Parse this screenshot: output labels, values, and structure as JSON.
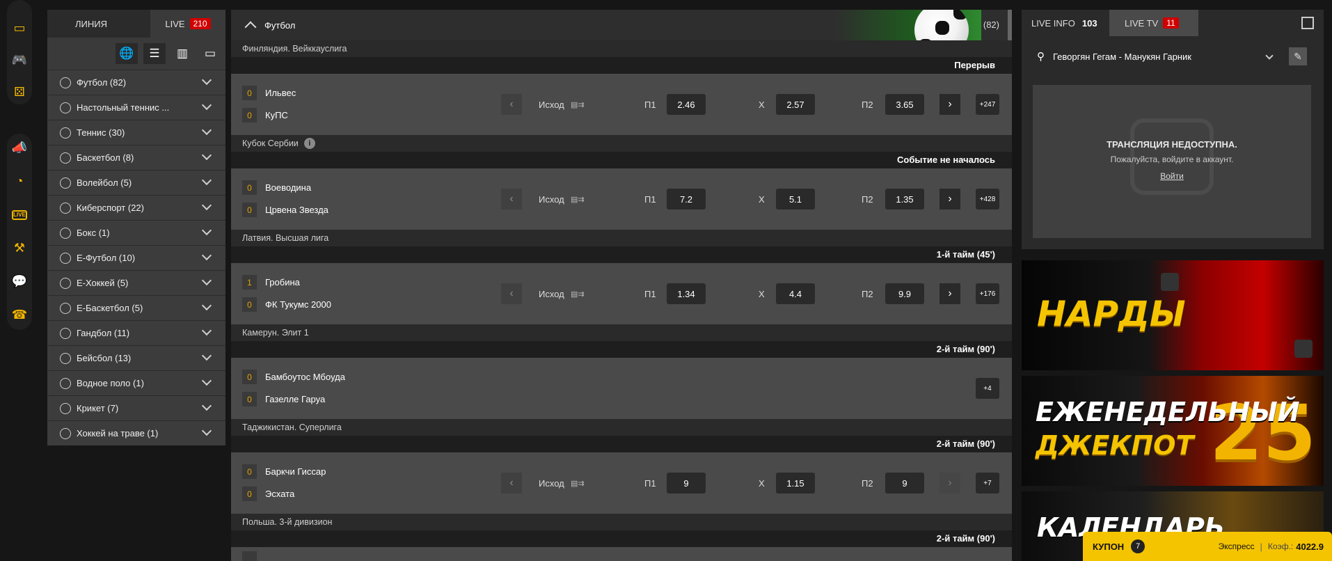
{
  "rail": {
    "icons": [
      "live-icon",
      "gamepad-icon",
      "dice-icon",
      "megaphone-icon",
      "pie-chart-icon",
      "live-small-icon",
      "gavel-icon",
      "chat-icon",
      "phone-icon"
    ],
    "live_small": "LIVE"
  },
  "sports_tabs": {
    "line": "ЛИНИЯ",
    "live": "LIVE",
    "live_count": "210"
  },
  "sports": [
    {
      "label": "Футбол (82)"
    },
    {
      "label": "Настольный теннис ..."
    },
    {
      "label": "Теннис (30)"
    },
    {
      "label": "Баскетбол (8)"
    },
    {
      "label": "Волейбол (5)"
    },
    {
      "label": "Киберспорт (22)"
    },
    {
      "label": "Бокс (1)"
    },
    {
      "label": "Е-Футбол (10)"
    },
    {
      "label": "Е-Хоккей (5)"
    },
    {
      "label": "Е-Баскетбол (5)"
    },
    {
      "label": "Гандбол (11)"
    },
    {
      "label": "Бейсбол (13)"
    },
    {
      "label": "Водное поло (1)"
    },
    {
      "label": "Крикет (7)"
    },
    {
      "label": "Хоккей на траве (1)"
    }
  ],
  "main": {
    "title": "Футбол",
    "count": "(82)"
  },
  "labels": {
    "outcome": "Исход",
    "p1": "П1",
    "x": "X",
    "p2": "П2"
  },
  "events": [
    {
      "league": "Финляндия. Вейккауслига",
      "status": "Перерыв",
      "team1": "Ильвес",
      "score1": "0",
      "team2": "КуПС",
      "score2": "0",
      "p1": "2.46",
      "x": "2.57",
      "p2": "3.65",
      "more": "+247",
      "has_odds": true
    },
    {
      "league": "Кубок Сербии",
      "status": "Событие не началось",
      "team1": "Воеводина",
      "score1": "0",
      "team2": "Црвена Звезда",
      "score2": "0",
      "p1": "7.2",
      "x": "5.1",
      "p2": "1.35",
      "more": "+428",
      "has_odds": true
    },
    {
      "league": "Латвия. Высшая лига",
      "status": "1-й тайм  (45')",
      "team1": "Гробина",
      "score1": "1",
      "team2": "ФК Тукумс 2000",
      "score2": "0",
      "p1": "1.34",
      "x": "4.4",
      "p2": "9.9",
      "more": "+176",
      "has_odds": true
    },
    {
      "league": "Камерун. Элит 1",
      "status": "2-й тайм  (90')",
      "team1": "Бамбоутос Мбоуда",
      "score1": "0",
      "team2": "Газелле Гаруа",
      "score2": "0",
      "more": "+4",
      "has_odds": false
    },
    {
      "league": "Таджикистан. Суперлига",
      "status": "2-й тайм  (90')",
      "team1": "Баркчи Гиссар",
      "score1": "0",
      "team2": "Эсхата",
      "score2": "0",
      "p1": "9",
      "x": "1.15",
      "p2": "9",
      "more": "+7",
      "has_odds": true
    },
    {
      "league": "Польша. 3-й дивизион",
      "status": "2-й тайм  (90')"
    }
  ],
  "right": {
    "tab_info": "LIVE INFO",
    "tab_info_count": "103",
    "tab_tv": "LIVE TV",
    "tab_tv_count": "11",
    "match": "Геворгян Гегам - Манукян Гарник",
    "unavailable": "ТРАНСЛЯЦИЯ НЕДОСТУПНА.",
    "login_prompt": "Пожалуйста, войдите в аккаунт.",
    "login_link": "Войти"
  },
  "banners": {
    "b1": "НАРДЫ",
    "b2_line1": "ЕЖЕНЕДЕЛЬНЫЙ",
    "b2_line2": "ДЖЕКПОТ",
    "b2_num": "25",
    "b3": "КАЛЕНДАРЬ"
  },
  "coupon": {
    "label": "КУПОН",
    "count": "7",
    "type": "Экспресс",
    "coef_label": "Коэф.:",
    "coef": "4022.9"
  },
  "colors": {
    "accent": "#f5c400",
    "live_badge": "#d10000",
    "score": "#e5a400"
  }
}
